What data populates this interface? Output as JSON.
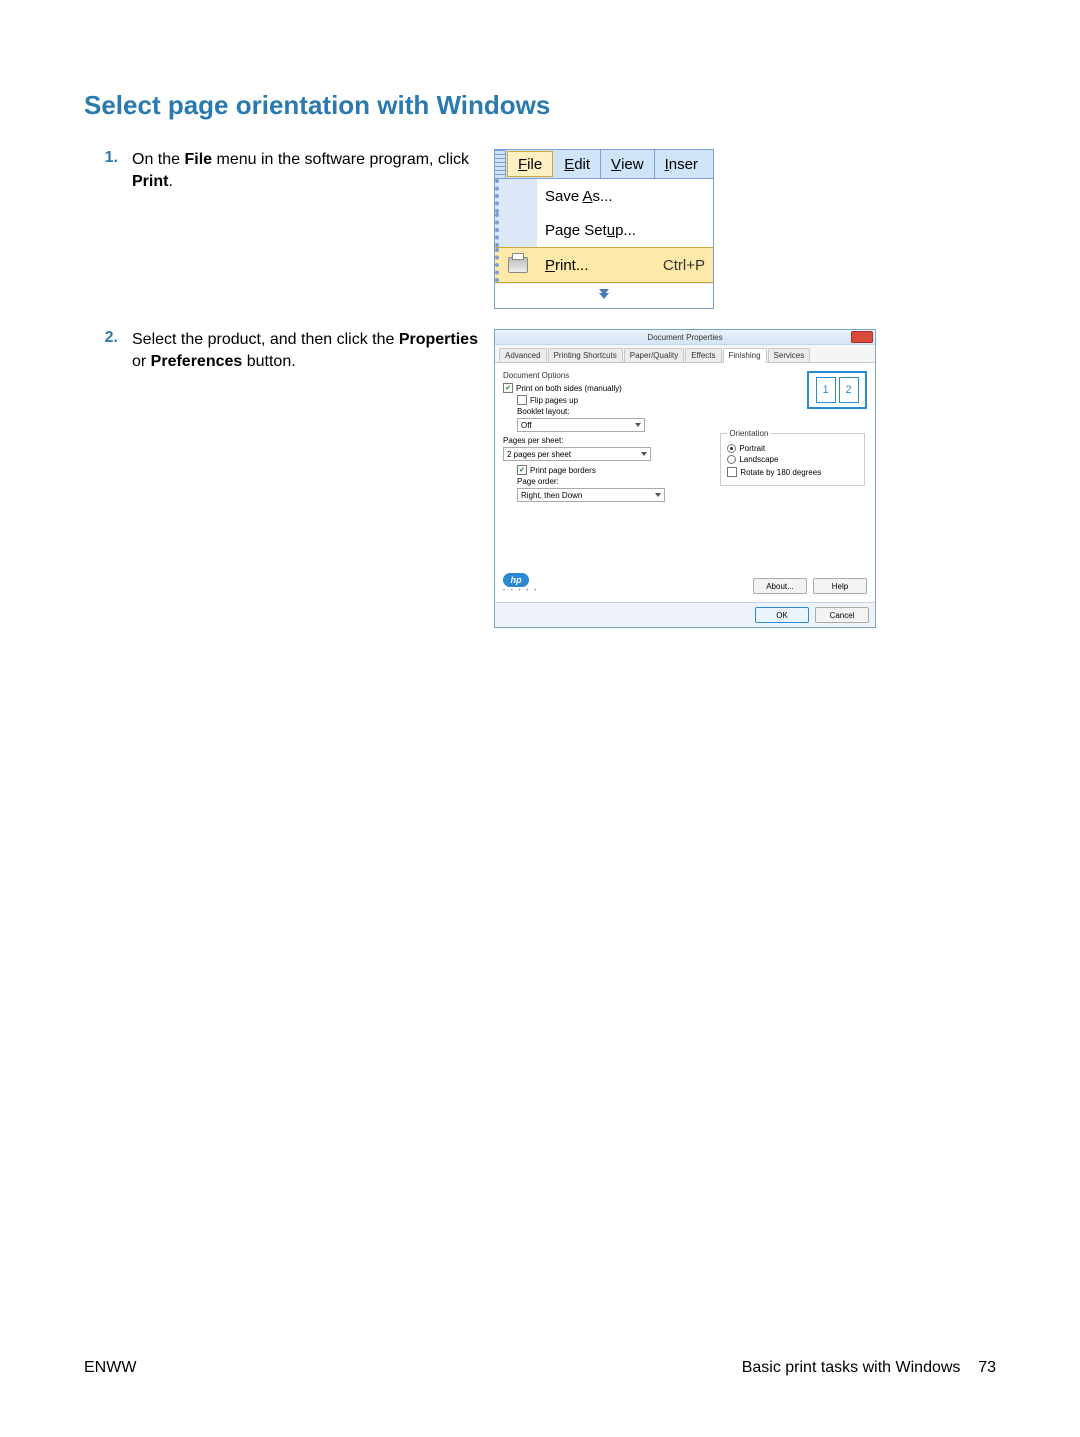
{
  "title": "Select page orientation with Windows",
  "steps": [
    {
      "num": "1.",
      "text_pre": "On the ",
      "bold1": "File",
      "text_mid": " menu in the software program, click ",
      "bold2": "Print",
      "text_post": "."
    },
    {
      "num": "2.",
      "text_pre": "Select the product, and then click the ",
      "bold1": "Properties",
      "text_mid": " or ",
      "bold2": "Preferences",
      "text_post": " button."
    }
  ],
  "filemenu": {
    "menubar": [
      "File",
      "Edit",
      "View",
      "Inser"
    ],
    "items": [
      {
        "label": "Save As...",
        "mnemonic_index": 5,
        "shortcut": ""
      },
      {
        "label": "Page Setup...",
        "mnemonic_index": 8,
        "shortcut": ""
      },
      {
        "label": "Print...",
        "mnemonic_index": 0,
        "shortcut": "Ctrl+P",
        "selected": true,
        "icon": "printer"
      }
    ]
  },
  "dialog": {
    "title": "Document Properties",
    "tabs": [
      "Advanced",
      "Printing Shortcuts",
      "Paper/Quality",
      "Effects",
      "Finishing",
      "Services"
    ],
    "active_tab": "Finishing",
    "doc_options_label": "Document Options",
    "print_both_sides": {
      "label": "Print on both sides (manually)",
      "checked": true
    },
    "flip_pages_up": {
      "label": "Flip pages up",
      "checked": false
    },
    "booklet_layout_label": "Booklet layout:",
    "booklet_layout_value": "Off",
    "pages_per_sheet_label": "Pages per sheet:",
    "pages_per_sheet_value": "2 pages per sheet",
    "print_page_borders": {
      "label": "Print page borders",
      "checked": true
    },
    "page_order_label": "Page order:",
    "page_order_value": "Right, then Down",
    "preview_pages": [
      "1",
      "2"
    ],
    "orientation_label": "Orientation",
    "orientation": {
      "portrait": "Portrait",
      "landscape": "Landscape",
      "rotate": "Rotate by 180 degrees",
      "selected": "Portrait"
    },
    "hp_logo_text": "hp",
    "about_btn": "About...",
    "help_btn": "Help",
    "ok_btn": "OK",
    "cancel_btn": "Cancel"
  },
  "footer": {
    "left": "ENWW",
    "right_text": "Basic print tasks with Windows",
    "page_num": "73"
  }
}
